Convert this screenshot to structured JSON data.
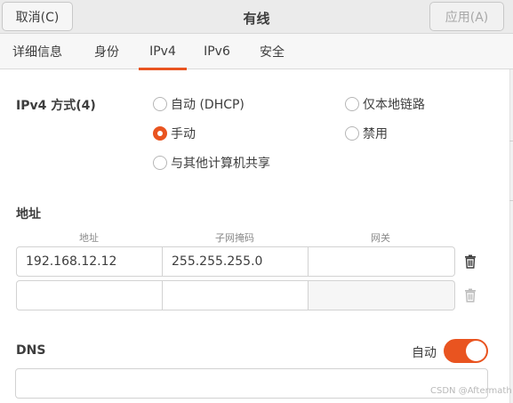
{
  "header": {
    "title": "有线",
    "cancel_label": "取消(C)",
    "apply_label": "应用(A)"
  },
  "tabs": [
    {
      "label": "详细信息",
      "active": false
    },
    {
      "label": "身份",
      "active": false
    },
    {
      "label": "IPv4",
      "active": true
    },
    {
      "label": "IPv6",
      "active": false
    },
    {
      "label": "安全",
      "active": false
    }
  ],
  "ipv4_method": {
    "label": "IPv4 方式(4)",
    "options": [
      {
        "label": "自动 (DHCP)",
        "checked": false
      },
      {
        "label": "仅本地链路",
        "checked": false
      },
      {
        "label": "手动",
        "checked": true
      },
      {
        "label": "禁用",
        "checked": false
      },
      {
        "label": "与其他计算机共享",
        "checked": false
      }
    ]
  },
  "addresses": {
    "section_label": "地址",
    "columns": [
      "地址",
      "子网掩码",
      "网关"
    ],
    "rows": [
      {
        "address": "192.168.12.12",
        "netmask": "255.255.255.0",
        "gateway": ""
      },
      {
        "address": "",
        "netmask": "",
        "gateway": ""
      }
    ]
  },
  "dns": {
    "label": "DNS",
    "auto_label": "自动",
    "auto_enabled": true,
    "value": ""
  },
  "colors": {
    "accent": "#e95420"
  },
  "icons": {
    "delete": "trash-icon"
  },
  "watermark": "CSDN @Aftermath"
}
